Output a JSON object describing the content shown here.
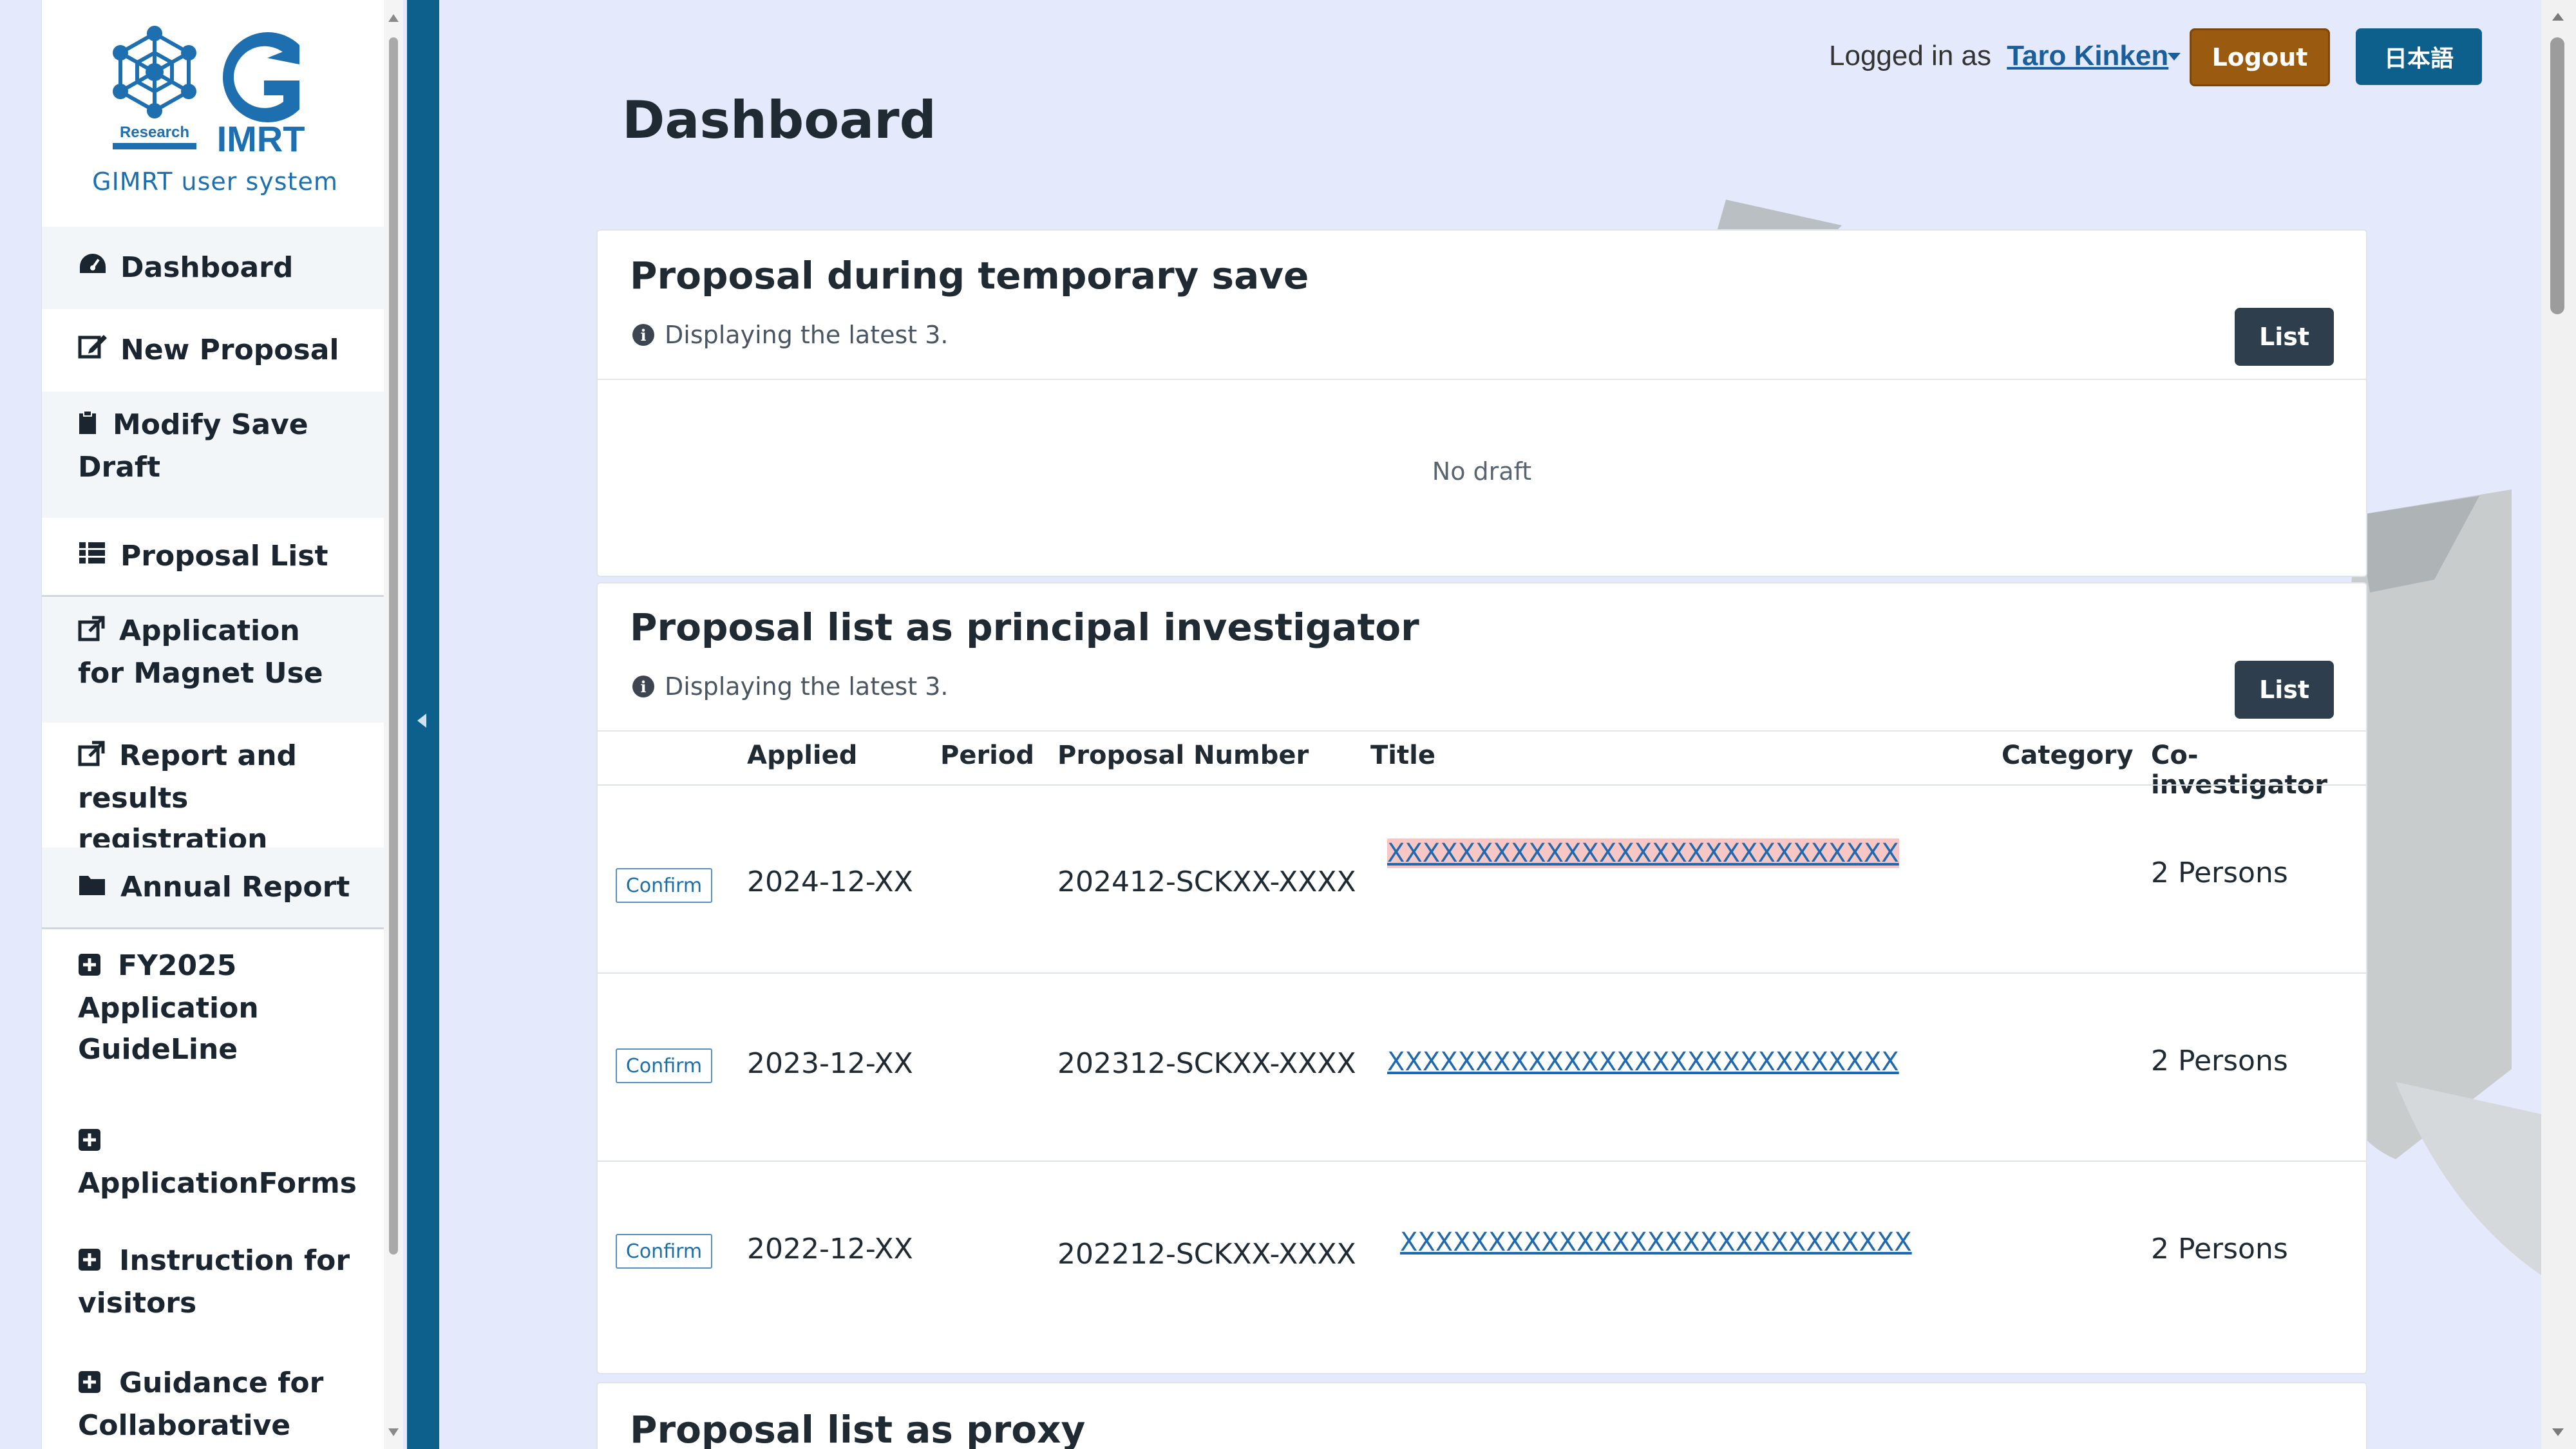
{
  "sidebar": {
    "logo": {
      "badge_text": "Research",
      "brand_text": "IMRT",
      "caption": "GIMRT user system"
    },
    "items": [
      {
        "label": "Dashboard",
        "icon": "dashboard-icon"
      },
      {
        "label": "New Proposal",
        "icon": "edit-icon"
      },
      {
        "label": "Modify Save Draft",
        "icon": "clipboard-icon"
      },
      {
        "label": "Proposal List",
        "icon": "list-icon"
      },
      {
        "label": "Application for Magnet Use",
        "icon": "external-link-icon"
      },
      {
        "label": "Report and results registration",
        "icon": "external-link-icon"
      },
      {
        "label": "Annual Report",
        "icon": "folder-icon"
      },
      {
        "label": "FY2025 Application GuideLine",
        "icon": "plus-square-icon"
      },
      {
        "label": "ApplicationForms",
        "icon": "plus-square-icon"
      },
      {
        "label": "Instruction for visitors",
        "icon": "plus-square-icon"
      },
      {
        "label": "Guidance for Collaborative",
        "icon": "plus-square-icon"
      }
    ]
  },
  "header": {
    "logged_in_prefix": "Logged in as",
    "user_name": "Taro Kinken",
    "logout_label": "Logout",
    "language_label": "日本語"
  },
  "page": {
    "title": "Dashboard"
  },
  "drafts": {
    "title": "Proposal during temporary save",
    "note": "Displaying the latest 3.",
    "list_label": "List",
    "empty_text": "No draft"
  },
  "pi_proposals": {
    "title": "Proposal list as principal investigator",
    "note": "Displaying the latest 3.",
    "list_label": "List",
    "columns": [
      "Applied",
      "Period",
      "Proposal Number",
      "Title",
      "Category",
      "Co-investigator"
    ],
    "rows": [
      {
        "action": "Confirm",
        "applied": "2024-12-XX",
        "period": "",
        "number": "202412-SCKXX-XXXX",
        "title": "XXXXXXXXXXXXXXXXXXXXXXXXXXXXX",
        "category": "",
        "co_investigator": "2 Persons",
        "highlighted": true
      },
      {
        "action": "Confirm",
        "applied": "2023-12-XX",
        "period": "",
        "number": "202312-SCKXX-XXXX",
        "title": "XXXXXXXXXXXXXXXXXXXXXXXXXXXXX",
        "category": "",
        "co_investigator": "2 Persons",
        "highlighted": false
      },
      {
        "action": "Confirm",
        "applied": "2022-12-XX",
        "period": "",
        "number": "202212-SCKXX-XXXX",
        "title": "XXXXXXXXXXXXXXXXXXXXXXXXXXXXX",
        "category": "",
        "co_investigator": "2 Persons",
        "highlighted": false
      }
    ]
  },
  "proxy_proposals": {
    "title": "Proposal list as proxy"
  },
  "colors": {
    "brand_blue": "#0d5f8c",
    "logout_brown": "#9a5a0f",
    "list_button": "#2f3e4c",
    "link_blue": "#1e69b0",
    "row_highlight": "#f6c7c4",
    "page_background": "#e4e9fb"
  }
}
